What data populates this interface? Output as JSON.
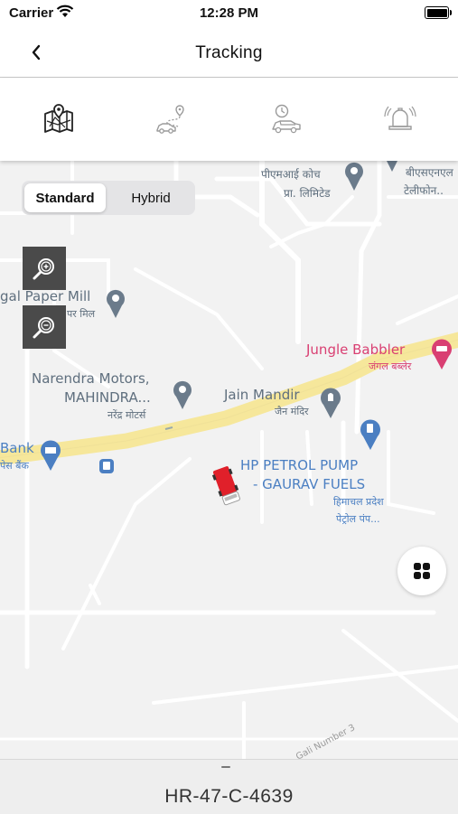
{
  "status_bar": {
    "carrier": "Carrier",
    "time": "12:28 PM"
  },
  "nav": {
    "title": "Tracking",
    "back_icon": "chevron-left-icon"
  },
  "tabs": [
    {
      "icon": "map-icon",
      "active": true
    },
    {
      "icon": "route-car-icon",
      "active": false
    },
    {
      "icon": "car-clock-icon",
      "active": false
    },
    {
      "icon": "bell-alert-icon",
      "active": false
    }
  ],
  "map": {
    "segmented_control": {
      "standard_label": "Standard",
      "hybrid_label": "Hybrid",
      "selected": "Standard"
    },
    "zoom_in_icon": "zoom-in-icon",
    "zoom_out_icon": "zoom-out-icon",
    "layers_icon": "grid-icon",
    "labels": {
      "pmi_coach_1": "पीएमआई कोच",
      "pmi_coach_2": "प्रा. लिमिटेड",
      "bsnl_1": "बीएसएनएल",
      "bsnl_2": "टेलीफोन..",
      "paper_mill": "gal Paper Mill",
      "paper_mill_hi": "पर मिल",
      "jungle_babbler": "Jungle Babbler",
      "jungle_babbler_hi": "जंगल बब्लेर",
      "narendra_1": "Narendra Motors,",
      "narendra_2": "MAHINDRA...",
      "narendra_hi": "नरेंद्र मोटर्स",
      "jain_mandir": "Jain Mandir",
      "jain_mandir_hi": "जैन मंदिर",
      "bank": "Bank",
      "bank_hi": "पेस बैंक",
      "hp_1": "HP PETROL PUMP",
      "hp_2": "- GAURAV FUELS",
      "hp_hi_1": "हिमाचल प्रदेश",
      "hp_hi_2": "पेट्रोल पंप...",
      "street": "Gali Number 3"
    },
    "colors": {
      "highway": "#f6e79b",
      "road": "#ffffff",
      "land": "#f2f2f2",
      "poi": "#6b7b8b",
      "pink": "#d93f72",
      "blue": "#4b7fc2",
      "vehicle": "#e0202a"
    }
  },
  "bottom_sheet": {
    "vehicle_number": "HR-47-C-4639"
  }
}
